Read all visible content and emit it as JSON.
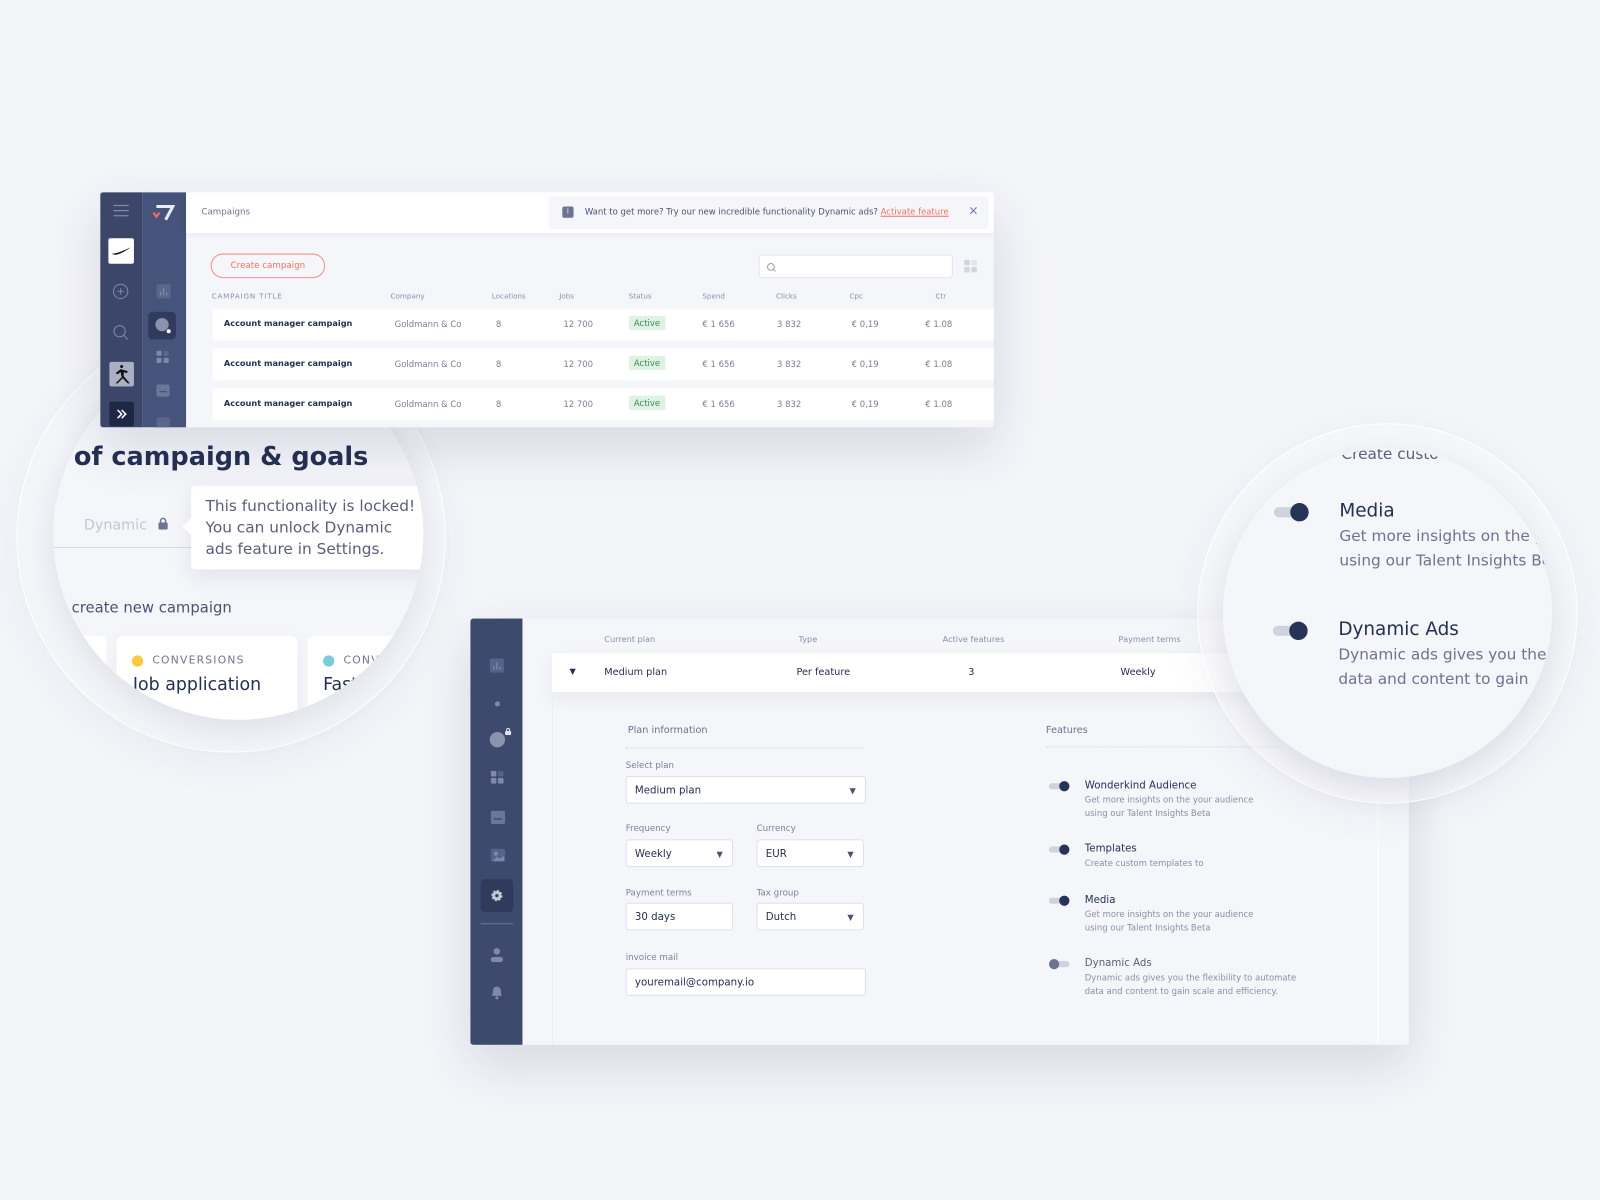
{
  "colors": {
    "accent": "#f0715f",
    "sidebar": "#3b4669",
    "active_green": "#3e8a57",
    "dark": "#252f52"
  },
  "campaigns": {
    "breadcrumb": "Campaigns",
    "banner": {
      "icon": "info-icon",
      "text": "Want to get more? Try our new incredible functionality Dynamic ads?",
      "link": "Activate feature",
      "close": "×"
    },
    "create_button": "Create campaign",
    "search_placeholder": "",
    "columns": [
      "CAMPAIGN TITLE",
      "Company",
      "Locations",
      "Jobs",
      "Status",
      "Spend",
      "Clicks",
      "Cpc",
      "Ctr"
    ],
    "rows": [
      [
        "Account manager campaign",
        "Goldmann & Co",
        "8",
        "12 700",
        "Active",
        "€ 1 656",
        "3 832",
        "€ 0,19",
        "€ 1.08"
      ],
      [
        "Account manager campaign",
        "Goldmann & Co",
        "8",
        "12 700",
        "Active",
        "€ 1 656",
        "3 832",
        "€ 0,19",
        "€ 1.08"
      ],
      [
        "Account manager campaign",
        "Goldmann & Co",
        "8",
        "12 700",
        "Active",
        "€ 1 656",
        "3 832",
        "€ 0,19",
        "€ 1.08"
      ]
    ],
    "brands": [
      "Nike",
      "Jordan",
      "Converse"
    ]
  },
  "zoom_left": {
    "heading": "of campaign & goals",
    "tab": "Dynamic",
    "tooltip": [
      "This functionality is locked!",
      "You can unlock Dynamic",
      "ads feature in Settings."
    ],
    "subheading": "create new campaign",
    "cards": [
      {
        "category": "CONVERSIONS",
        "title": "Job application",
        "dot": "#f9c940"
      },
      {
        "category": "CONV",
        "title": "Fast",
        "dot": "#7ccbd8"
      }
    ]
  },
  "plan": {
    "columns": [
      "Current plan",
      "Type",
      "Active features",
      "Payment terms"
    ],
    "row": {
      "plan": "Medium plan",
      "type": "Per feature",
      "active_features": "3",
      "payment_terms": "Weekly"
    },
    "info_title": "Plan information",
    "fields": {
      "select_plan": {
        "label": "Select plan",
        "value": "Medium plan"
      },
      "frequency": {
        "label": "Frequency",
        "value": "Weekly"
      },
      "currency": {
        "label": "Currency",
        "value": "EUR"
      },
      "payment_terms": {
        "label": "Payment terms",
        "value": "30 days"
      },
      "tax_group": {
        "label": "Tax group",
        "value": "Dutch"
      },
      "invoice_mail": {
        "label": "invoice mail",
        "value": "youremail@company.io"
      }
    },
    "features_title": "Features",
    "features": [
      {
        "title": "Wonderkind Audience",
        "desc": "Get more insights on the your audience using our Talent Insights Beta",
        "on": true
      },
      {
        "title": "Templates",
        "desc": "Create custom templates to",
        "on": true
      },
      {
        "title": "Media",
        "desc": "Get more insights on the your audience using our Talent Insights Beta",
        "on": true
      },
      {
        "title": "Dynamic Ads",
        "desc": "Dynamic ads gives you the flexibility to automate data and content to gain scale and efficiency.",
        "on": false
      }
    ]
  },
  "zoom_right": {
    "top_text": "Create custo",
    "items": [
      {
        "title": "Media",
        "lines": [
          "Get more insights on the y",
          "using our Talent Insights Be"
        ],
        "on": true
      },
      {
        "title": "Dynamic Ads",
        "lines": [
          "Dynamic ads gives you the",
          "data and content to gain"
        ],
        "on": true
      }
    ]
  }
}
